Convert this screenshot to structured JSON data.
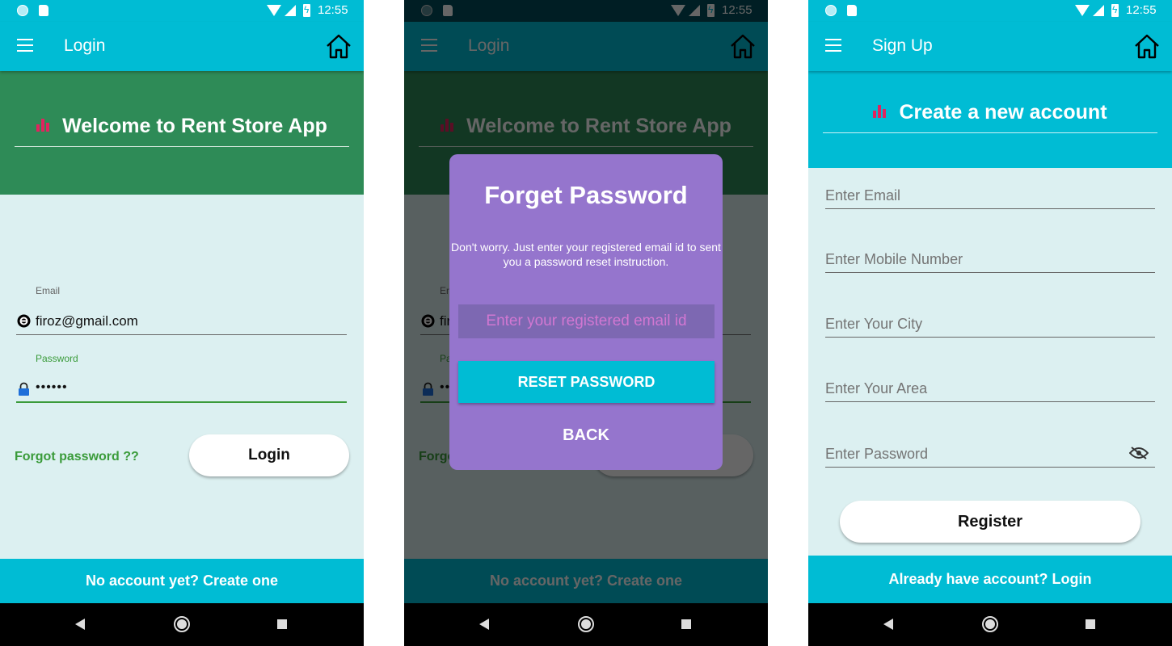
{
  "status": {
    "time": "12:55"
  },
  "login": {
    "appbar_title": "Login",
    "welcome": "Welcome to Rent Store App",
    "email_label": "Email",
    "email_value": "firoz@gmail.com",
    "password_label": "Password",
    "password_value": "••••••",
    "forgot": "Forgot password ??",
    "login_button": "Login",
    "create_link": "No account yet? Create one",
    "colors": {
      "header": "#2e8b57",
      "accent": "#00bcd4",
      "password_label": "#3a9b3a"
    }
  },
  "dialog": {
    "title": "Forget Password",
    "message": "Don't worry. Just enter your registered email id to sent you a password reset instruction.",
    "email_placeholder": "Enter your registered email id",
    "reset_button": "RESET PASSWORD",
    "back_button": "BACK",
    "background_color": "#9575cd"
  },
  "signup": {
    "appbar_title": "Sign Up",
    "header": "Create a new account",
    "fields": [
      {
        "placeholder": "Enter Email"
      },
      {
        "placeholder": "Enter Mobile Number"
      },
      {
        "placeholder": "Enter Your City"
      },
      {
        "placeholder": "Enter Your Area"
      },
      {
        "placeholder": "Enter Password",
        "icon": "eye-off-icon"
      }
    ],
    "register_button": "Register",
    "login_link": "Already have account? Login"
  },
  "icons": [
    "menu-icon",
    "home-icon",
    "bar-chart-icon",
    "email-at-icon",
    "lock-icon",
    "eye-off-icon"
  ]
}
